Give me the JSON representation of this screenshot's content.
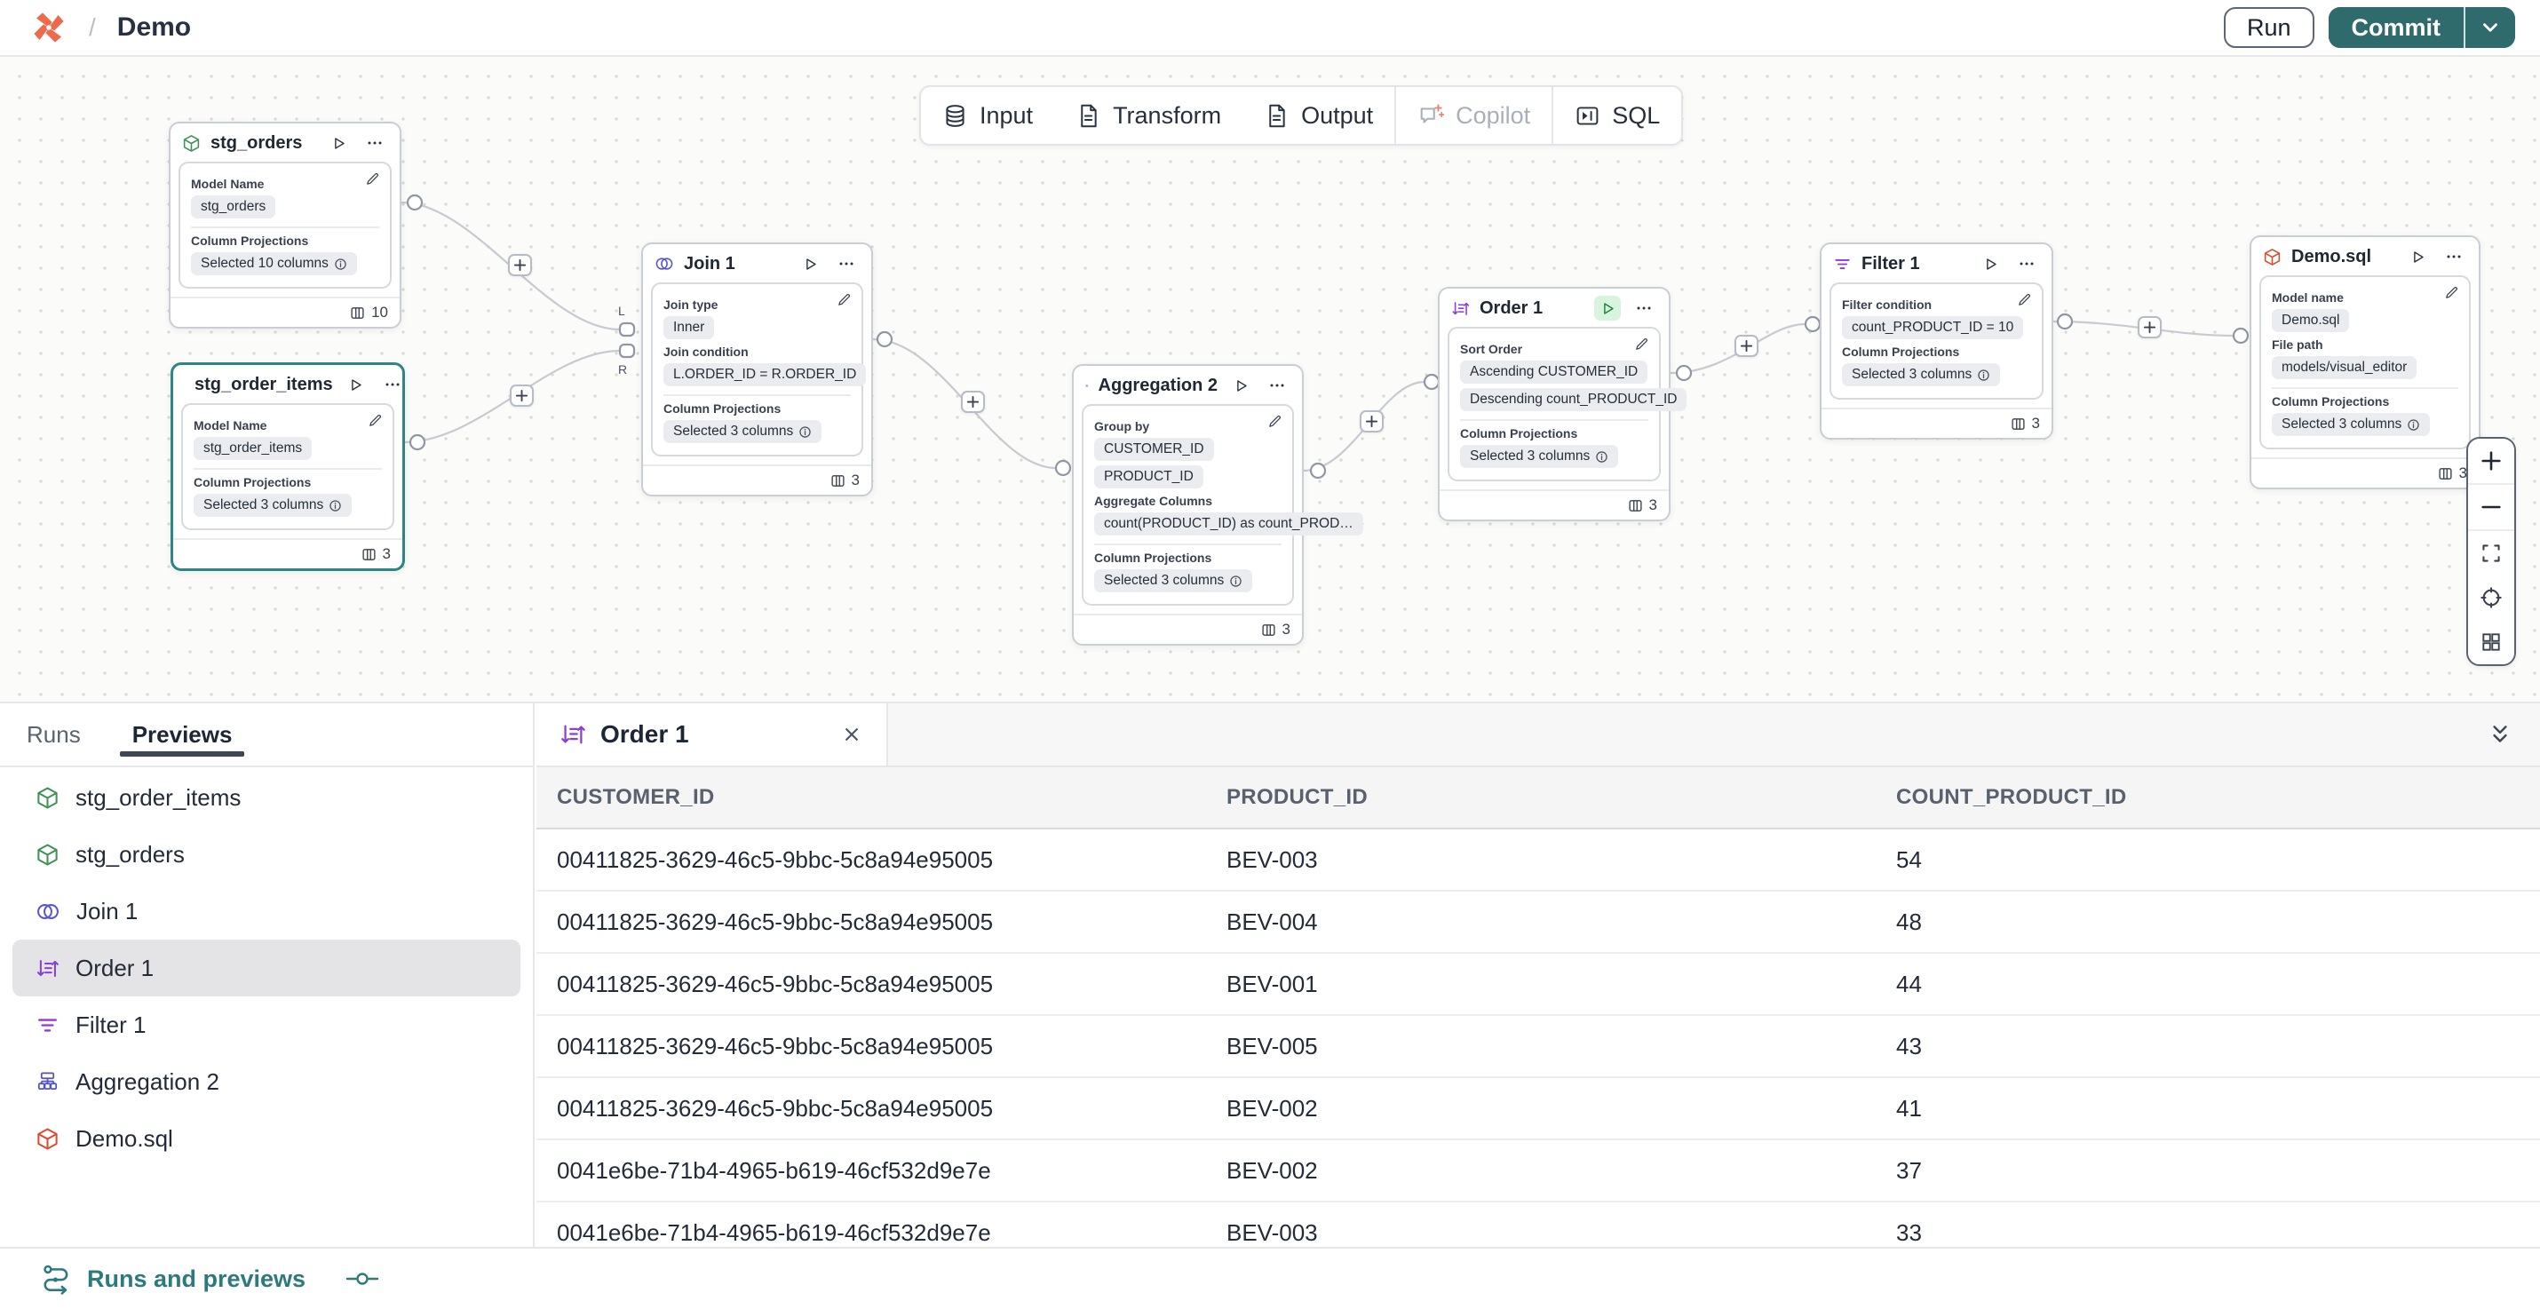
{
  "header": {
    "separator": "/",
    "title": "Demo",
    "run_label": "Run",
    "commit_label": "Commit"
  },
  "toolbar": {
    "input": "Input",
    "transform": "Transform",
    "output": "Output",
    "copilot": "Copilot",
    "sql": "SQL"
  },
  "nodes": {
    "stg_orders": {
      "title": "stg_orders",
      "model_label": "Model Name",
      "model": "stg_orders",
      "proj_label": "Column Projections",
      "proj": "Selected 10 columns",
      "count": "10"
    },
    "stg_order_items": {
      "title": "stg_order_items",
      "model_label": "Model Name",
      "model": "stg_order_items",
      "proj_label": "Column Projections",
      "proj": "Selected 3 columns",
      "count": "3"
    },
    "join1": {
      "title": "Join 1",
      "type_label": "Join type",
      "type": "Inner",
      "cond_label": "Join condition",
      "cond": "L.ORDER_ID = R.ORDER_ID",
      "proj_label": "Column Projections",
      "proj": "Selected 3 columns",
      "count": "3",
      "port_l": "L",
      "port_r": "R"
    },
    "aggregation2": {
      "title": "Aggregation 2",
      "group_label": "Group by",
      "group1": "CUSTOMER_ID",
      "group2": "PRODUCT_ID",
      "agg_label": "Aggregate Columns",
      "agg": "count(PRODUCT_ID) as count_PROD…",
      "proj_label": "Column Projections",
      "proj": "Selected 3 columns",
      "count": "3"
    },
    "order1": {
      "title": "Order 1",
      "sort_label": "Sort Order",
      "sort1": "Ascending CUSTOMER_ID",
      "sort2": "Descending count_PRODUCT_ID",
      "proj_label": "Column Projections",
      "proj": "Selected 3 columns",
      "count": "3"
    },
    "filter1": {
      "title": "Filter 1",
      "cond_label": "Filter condition",
      "cond": "count_PRODUCT_ID = 10",
      "proj_label": "Column Projections",
      "proj": "Selected 3 columns",
      "count": "3"
    },
    "demo_sql": {
      "title": "Demo.sql",
      "model_label": "Model name",
      "model": "Demo.sql",
      "path_label": "File path",
      "path": "models/visual_editor",
      "proj_label": "Column Projections",
      "proj": "Selected 3 columns",
      "count": "3"
    }
  },
  "panel": {
    "runs_tab": "Runs",
    "previews_tab": "Previews",
    "items": [
      {
        "label": "stg_order_items",
        "icon": "cube-green"
      },
      {
        "label": "stg_orders",
        "icon": "cube-green"
      },
      {
        "label": "Join 1",
        "icon": "join"
      },
      {
        "label": "Order 1",
        "icon": "sort"
      },
      {
        "label": "Filter 1",
        "icon": "filter"
      },
      {
        "label": "Aggregation 2",
        "icon": "aggregation"
      },
      {
        "label": "Demo.sql",
        "icon": "cube-red"
      }
    ]
  },
  "preview": {
    "tab_title": "Order 1",
    "table": {
      "headers": [
        "CUSTOMER_ID",
        "PRODUCT_ID",
        "COUNT_PRODUCT_ID"
      ],
      "rows": [
        [
          "00411825-3629-46c5-9bbc-5c8a94e95005",
          "BEV-003",
          "54"
        ],
        [
          "00411825-3629-46c5-9bbc-5c8a94e95005",
          "BEV-004",
          "48"
        ],
        [
          "00411825-3629-46c5-9bbc-5c8a94e95005",
          "BEV-001",
          "44"
        ],
        [
          "00411825-3629-46c5-9bbc-5c8a94e95005",
          "BEV-005",
          "43"
        ],
        [
          "00411825-3629-46c5-9bbc-5c8a94e95005",
          "BEV-002",
          "41"
        ],
        [
          "0041e6be-71b4-4965-b619-46cf532d9e7e",
          "BEV-002",
          "37"
        ],
        [
          "0041e6be-71b4-4965-b619-46cf532d9e7e",
          "BEV-003",
          "33"
        ]
      ]
    }
  },
  "statusbar": {
    "label": "Runs and previews"
  },
  "colors": {
    "accent_teal": "#2f6b6d",
    "statusbar_teal": "#2c7a7b",
    "logo_orange": "#ee6a4d",
    "selected_node_border": "#2e8585",
    "icon_green": "#3f9154",
    "icon_red": "#dd4a30",
    "icon_join_blue": "#5856d6",
    "icon_sort_purple": "#8b3fd6",
    "icon_filter_purple": "#9333ea",
    "icon_agg_indigo": "#5352cc"
  }
}
